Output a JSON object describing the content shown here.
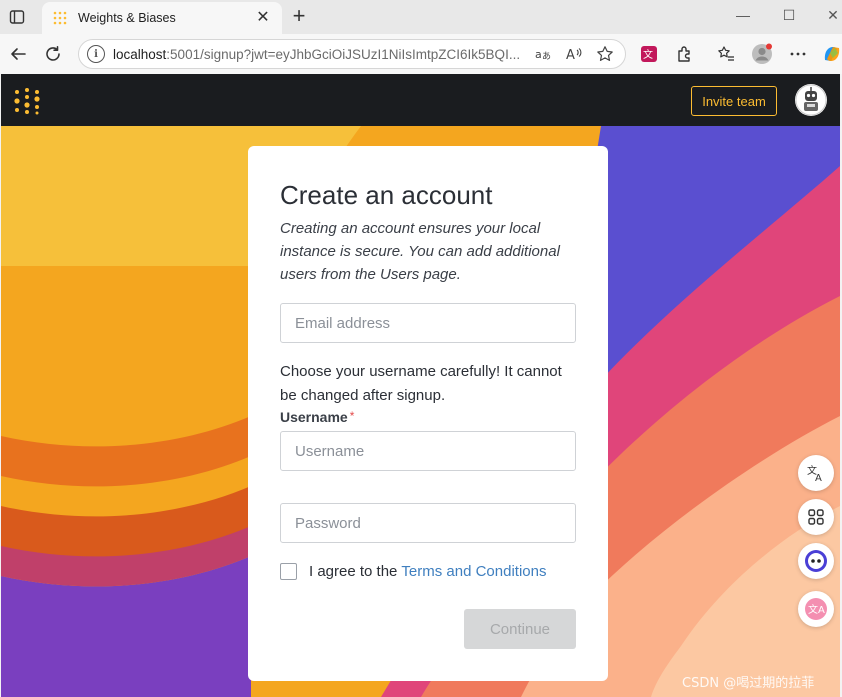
{
  "browser": {
    "tab_title": "Weights & Biases",
    "tab_close": "✕",
    "new_tab": "+",
    "window_controls": {
      "minimize": "—",
      "maximize": "☐",
      "close": "✕"
    },
    "address_host": "localhost",
    "address_rest": ":5001/signup?jwt=eyJhbGciOiJSUzI1NiIsImtpZCI6Ik5BQI...",
    "addr_read_aloud": "aͣ",
    "addr_text_size": "A↗"
  },
  "app": {
    "invite_label": "Invite team"
  },
  "signup": {
    "title": "Create an account",
    "subtitle": "Creating an account ensures your local instance is secure. You can add additional users from the Users page.",
    "email_placeholder": "Email address",
    "username_note": "Choose your username carefully! It cannot be changed after signup.",
    "username_label": "Username",
    "required_mark": "*",
    "username_placeholder": "Username",
    "password_placeholder": "Password",
    "agree_text": "I agree to the",
    "terms_link": "Terms and Conditions",
    "continue_label": "Continue"
  },
  "watermark": "CSDN @喝过期的拉菲",
  "colors": {
    "accent": "#fcbc32",
    "link": "#3f7fbf",
    "topbar": "#1a1c1f",
    "disabled_button": "#d6d7d8"
  }
}
